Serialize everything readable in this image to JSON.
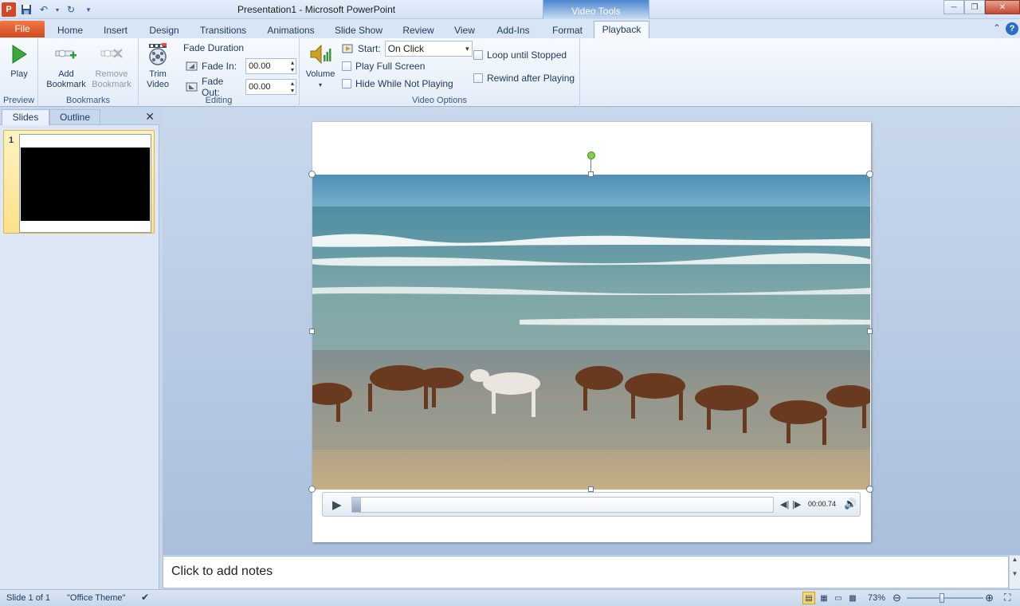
{
  "window": {
    "title": "Presentation1  -  Microsoft PowerPoint",
    "context_tab_group": "Video Tools"
  },
  "colors": {
    "file_tab": "#e0592d",
    "ribbon_bg": "#eef4fb",
    "accent": "#2b5797",
    "slide_bg": "#ffffff",
    "selection_highlight": "#fde18a"
  },
  "tabs": [
    {
      "label": "File"
    },
    {
      "label": "Home"
    },
    {
      "label": "Insert"
    },
    {
      "label": "Design"
    },
    {
      "label": "Transitions"
    },
    {
      "label": "Animations"
    },
    {
      "label": "Slide Show"
    },
    {
      "label": "Review"
    },
    {
      "label": "View"
    },
    {
      "label": "Add-Ins"
    },
    {
      "label": "Format"
    },
    {
      "label": "Playback"
    }
  ],
  "active_tab": "Playback",
  "ribbon": {
    "preview": {
      "play_label": "Play",
      "group_label": "Preview"
    },
    "bookmarks": {
      "add_label_1": "Add",
      "add_label_2": "Bookmark",
      "remove_label_1": "Remove",
      "remove_label_2": "Bookmark",
      "group_label": "Bookmarks"
    },
    "editing": {
      "trim_label_1": "Trim",
      "trim_label_2": "Video",
      "fade_duration_label": "Fade Duration",
      "fade_in_label": "Fade In:",
      "fade_in_value": "00.00",
      "fade_out_label": "Fade Out:",
      "fade_out_value": "00.00",
      "group_label": "Editing"
    },
    "video_options": {
      "volume_label": "Volume",
      "start_label": "Start:",
      "start_value": "On Click",
      "play_full_screen": "Play Full Screen",
      "hide_while_not_playing": "Hide While Not Playing",
      "loop_until_stopped": "Loop until Stopped",
      "rewind_after_playing": "Rewind after Playing",
      "group_label": "Video Options"
    }
  },
  "side_pane": {
    "tabs": [
      "Slides",
      "Outline"
    ],
    "slide_number": "1"
  },
  "video_player": {
    "time": "00:00.74",
    "progress": 0.02
  },
  "notes": {
    "placeholder": "Click to add notes"
  },
  "status_bar": {
    "slide_info": "Slide 1 of 1",
    "theme": "\"Office Theme\"",
    "zoom": "73%",
    "zoom_level": 0.46
  }
}
